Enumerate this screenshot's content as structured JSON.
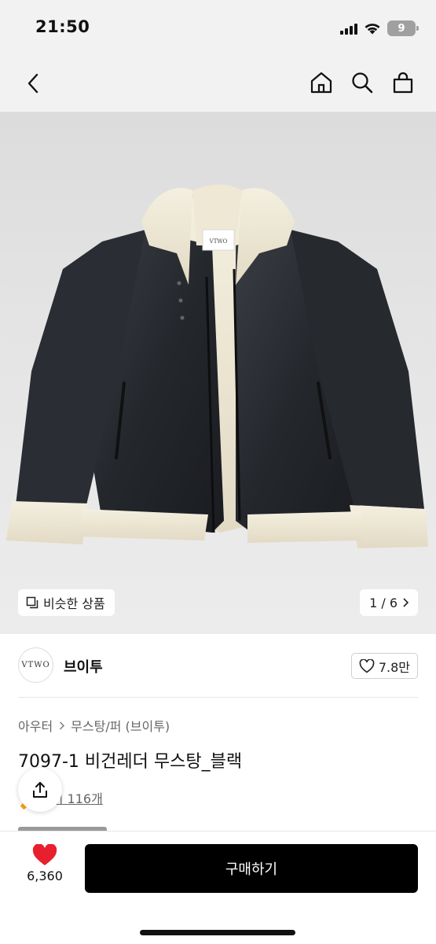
{
  "status_bar": {
    "time": "21:50",
    "battery_level": "9"
  },
  "nav": {
    "back_icon": "chevron-left-icon",
    "home_icon": "home-icon",
    "search_icon": "search-icon",
    "cart_icon": "shopping-bag-icon"
  },
  "gallery": {
    "similar_label": "비슷한 상품",
    "counter": "1 / 6",
    "image_brand_tag": "VTWO"
  },
  "brand": {
    "logo_text": "VTWO",
    "name": "브이투",
    "likes": "7.8만"
  },
  "product": {
    "breadcrumb": [
      "아우터",
      "무스탕/퍼 (브이투)"
    ],
    "title": "7097-1 비건레더 무스탕_블랙",
    "review_link": "후기 116개"
  },
  "bottom": {
    "wish_count": "6,360",
    "buy_label": "구매하기"
  },
  "colors": {
    "accent_red": "#e8202e",
    "buy_button": "#000000",
    "star": "#f7a41c"
  }
}
